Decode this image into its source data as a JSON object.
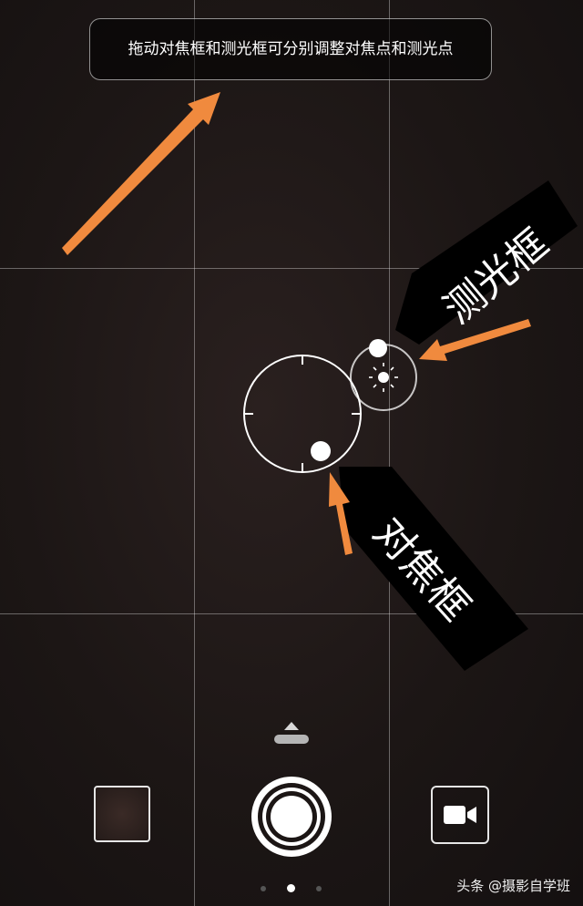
{
  "hint": {
    "text": "拖动对焦框和测光框可分别调整对焦点和测光点"
  },
  "callouts": {
    "metering_label": "测光框",
    "focus_label": "对焦框"
  },
  "icons": {
    "focus_ring": "focus-ring-icon",
    "metering_ring": "sun-icon",
    "video": "video-camera-icon",
    "shutter": "shutter-icon",
    "handle": "chevron-up-icon"
  },
  "pager": {
    "count": 3,
    "active_index": 1
  },
  "watermark": {
    "text": "头条 @摄影自学班"
  },
  "colors": {
    "annotation_arrow": "#f08a3e",
    "background": "#1c1615",
    "foreground": "#ffffff"
  }
}
